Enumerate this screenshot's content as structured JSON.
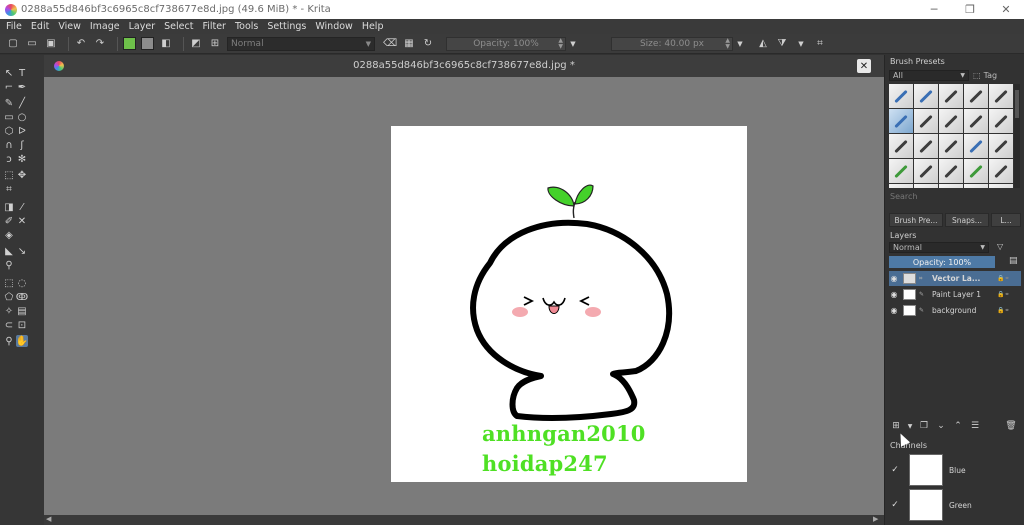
{
  "window": {
    "title": "0288a55d846bf3c6965c8cf738677e8d.jpg (49.6 MiB)  * - Krita",
    "minimize_glyph": "─",
    "restore_glyph": "❐",
    "close_glyph": "✕"
  },
  "menu": {
    "items": [
      "File",
      "Edit",
      "View",
      "Image",
      "Layer",
      "Select",
      "Filter",
      "Tools",
      "Settings",
      "Window",
      "Help"
    ]
  },
  "toolbar": {
    "foreground_color": "#6ec04a",
    "background_color": "#8c8c8c",
    "blend_mode": "Normal",
    "opacity_label": "Opacity: 100%",
    "size_label": "Size: 40.00 px"
  },
  "document": {
    "tab_title": "0288a55d846bf3c6965c8cf738677e8d.jpg *",
    "close_glyph": "✕",
    "watermark_line1": "anhngan2010",
    "watermark_line2": "hoidap247",
    "face_text": "> ᴗ <"
  },
  "brush_presets": {
    "title": "Brush Presets",
    "filter_value": "All",
    "tag_label": "Tag",
    "search_placeholder": "Search"
  },
  "dock_tabs": [
    "Brush Pre...",
    "Snaps...",
    "L..."
  ],
  "layers": {
    "title": "Layers",
    "blend_mode": "Normal",
    "opacity_label": "Opacity:  100%",
    "items": [
      {
        "name": "Vector La...",
        "active": true
      },
      {
        "name": "Paint Layer 1",
        "active": false
      },
      {
        "name": "background",
        "active": false
      }
    ]
  },
  "channels": {
    "title": "Channels",
    "items": [
      {
        "name": "Blue"
      },
      {
        "name": "Green"
      }
    ]
  },
  "colors": {
    "accent": "#4e7aa6",
    "watermark": "#4fe024",
    "sprout": "#44d12a"
  }
}
